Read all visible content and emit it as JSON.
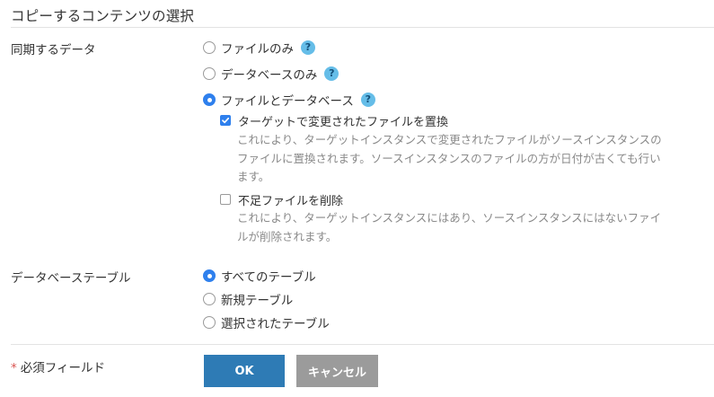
{
  "title": "コピーするコンテンツの選択",
  "sync": {
    "label": "同期するデータ",
    "options": [
      {
        "label": "ファイルのみ",
        "selected": false,
        "help_icon": "question-icon"
      },
      {
        "label": "データベースのみ",
        "selected": false,
        "help_icon": "question-icon"
      },
      {
        "label": "ファイルとデータベース",
        "selected": true,
        "help_icon": "question-icon"
      }
    ],
    "help_glyph": "?",
    "replace_files": {
      "label": "ターゲットで変更されたファイルを置換",
      "checked": true,
      "description_lines": [
        "これにより、ターゲットインスタンスで変更されたファイルがソースインスタンスの",
        "ファイルに置換されます。ソースインスタンスのファイルの方が日付が古くても行い",
        "ます。"
      ]
    },
    "delete_missing": {
      "label": "不足ファイルを削除",
      "checked": false,
      "description_lines": [
        "これにより、ターゲットインスタンスにはあり、ソースインスタンスにはないファイ",
        "ルが削除されます。"
      ]
    }
  },
  "tables": {
    "label": "データベーステーブル",
    "options": [
      {
        "label": "すべてのテーブル",
        "selected": true
      },
      {
        "label": "新規テーブル",
        "selected": false
      },
      {
        "label": "選択されたテーブル",
        "selected": false
      }
    ]
  },
  "required": {
    "star": "*",
    "label": "必須フィールド"
  },
  "buttons": {
    "ok": "OK",
    "cancel": "キャンセル"
  },
  "colors": {
    "accent": "#2f80ed",
    "ok_button": "#2e7bb5",
    "cancel_button": "#9b9b9b",
    "help_badge": "#65bde8",
    "required_star": "#d9534f"
  }
}
